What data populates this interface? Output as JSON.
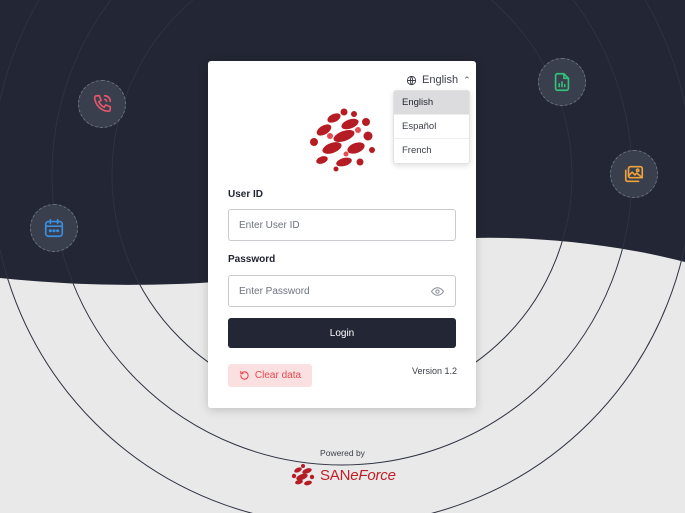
{
  "language": {
    "current": "English",
    "options": [
      {
        "label": "English",
        "selected": true
      },
      {
        "label": "Español",
        "selected": false
      },
      {
        "label": "French",
        "selected": false
      }
    ]
  },
  "form": {
    "user_id_label": "User ID",
    "user_id_placeholder": "Enter User ID",
    "password_label": "Password",
    "password_placeholder": "Enter Password",
    "login_label": "Login",
    "clear_label": "Clear data",
    "version": "Version 1.2"
  },
  "footer": {
    "powered_by": "Powered by",
    "brand_prefix": "SAN",
    "brand_e": "e",
    "brand_suffix": "Force"
  },
  "decor_icons": [
    "phone-call-icon",
    "calendar-icon",
    "document-chart-icon",
    "image-gallery-icon"
  ],
  "colors": {
    "dark_bg": "#232634",
    "light_bg": "#e9e9e9",
    "brand_red": "#c0202a",
    "danger": "#e5484d"
  }
}
